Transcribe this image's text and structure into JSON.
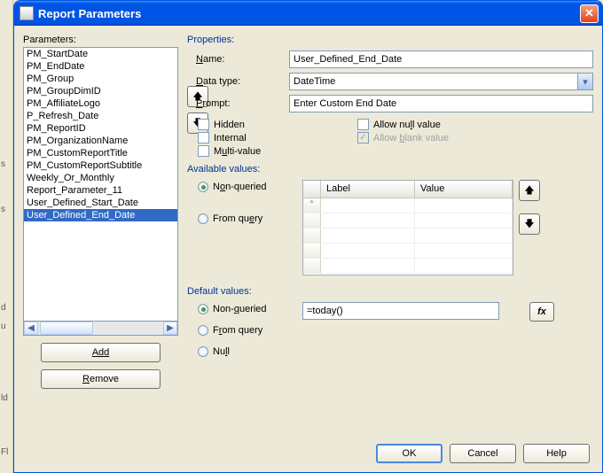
{
  "window": {
    "title": "Report Parameters"
  },
  "left": {
    "header": "Parameters:",
    "items": [
      "PM_StartDate",
      "PM_EndDate",
      "PM_Group",
      "PM_GroupDimID",
      "PM_AffiliateLogo",
      "P_Refresh_Date",
      "PM_ReportID",
      "PM_OrganizationName",
      "PM_CustomReportTitle",
      "PM_CustomReportSubtitle",
      "Weekly_Or_Monthly",
      "Report_Parameter_11",
      "User_Defined_Start_Date",
      "User_Defined_End_Date"
    ],
    "selected_index": 13,
    "add_btn": "Add",
    "remove_btn": "Remove"
  },
  "props": {
    "section": "Properties:",
    "name_label": "Name:",
    "name_value": "User_Defined_End_Date",
    "datatype_label": "Data type:",
    "datatype_value": "DateTime",
    "prompt_label": "Prompt:",
    "prompt_value": "Enter Custom End Date",
    "hidden": "Hidden",
    "internal": "Internal",
    "multivalue": "Multi-value",
    "allow_null": "Allow null value",
    "allow_blank": "Allow blank value"
  },
  "avail": {
    "section": "Available values:",
    "nonq": "Non-queried",
    "fromq": "From query",
    "col_label": "Label",
    "col_value": "Value"
  },
  "defv": {
    "section": "Default values:",
    "nonq": "Non-queried",
    "fromq": "From query",
    "null": "Null",
    "expr": "=today()",
    "fx": "fx"
  },
  "footer": {
    "ok": "OK",
    "cancel": "Cancel",
    "help": "Help"
  }
}
